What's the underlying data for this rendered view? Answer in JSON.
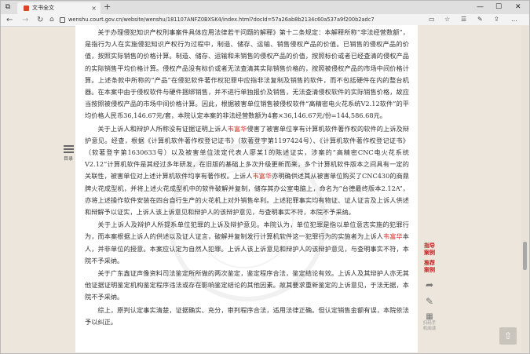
{
  "browser": {
    "tab_title": "文书全文",
    "tab_close": "×",
    "new_tab": "+",
    "url": "wenshu.court.gov.cn/website/wenshu/181107ANFZ0BXSK4/index.html?docId=57a26ab8b2134c60a537a9f200b2adc7",
    "controls": {
      "minimize": "—",
      "maximize": "☐",
      "close": "✕"
    },
    "nav": {
      "back": "←",
      "forward": "→",
      "refresh": "↻"
    },
    "toolbar_icons": [
      "reading-view-icon",
      "favorites-star-icon",
      "favorites-list-icon",
      "pen-icon",
      "share-icon",
      "more-icon"
    ]
  },
  "document": {
    "paragraphs": [
      [
        {
          "t": "关于办理侵犯知识产权刑事案件具体应用法律若干问题的解释》第十二条规定：本解释所称“非法经营数额”，是指行为人在实施侵犯知识产权行为过程中，制造、储存、运输、销售侵权产品的价值。已销售的侵权产品的价值，按照实际销售的价格计算。制造、储存、运输和未销售的侵权产品的价值，按照标价或者已经查清的侵权产品的实际销售平均价格计算。侵权产品没有标价或者无法查清其实际销售价格的，按照被侵权产品的市场中间价格计算。上述条款中所称的“产品”在侵犯软件著作权犯罪中应指非法复制及销售的软件，而不包括硬件在内的整台机器。在本案中由于侵权软件与硬件捆绑销售，并不进行单独报价及销售，无法查清侵权软件的实际销售价格，故应当按照被侵权产品的市场中间价格计算。因此，根据被害单位销售被侵权软件“高精密电火花系统V2.12软件”的平均价格人民币36,146.67元/套，本院认定本案的非法经营数额为4套×36,146.67元/份=144,586.68元。"
        }
      ],
      [
        {
          "t": "关于上诉人和辩护人所称没有证据证明上诉人"
        },
        {
          "t": "韦富华",
          "red": true
        },
        {
          "t": "侵害了被害单位享有计算机软件著作权的软件的上诉及辩护意见。经查，根据《计算机软件著作权登记证书》（软著登字第1197424号）、《计算机软件著作权登记证书》（软著登字第1630633号）以及被害单位法定代表人廖某1的陈述证实，涉案的“高精密CNC电火花系统V2.12”计算机软件是其经过多年研发，在旧版的基础上多次升级更新而来，多个计算机软件版本之间具有一定的关联性，被害单位对上述计算机软件均享有著作权。上诉人"
        },
        {
          "t": "韦富华",
          "red": true
        },
        {
          "t": "亦明确供述其从被害单位购买了CNC430的商鼎牌火花成型机，并将上述火花成型机中的软件破解并复制，储存其办公室电脑上，命名为“台德最终版本2.12A”，亦将上述操作软件安装在四台自行生产的火花机上对外销售牟利。上述犯罪事实均有物证、证人证言及上诉人供述和辩解予以证实，上诉人该上诉意见和辩护人的该辩护意见，与查明事实不符，本院不予采纳。"
        }
      ],
      [
        {
          "t": "关于上诉人及辩护人所提系单位犯罪的上诉及辩护意见。本院认为，单位犯罪是指以单位意志实施的犯罪行为，而本案根据上诉人的供述以及证人证言，破解并复制发行计算机软件这一犯罪行为的实施者为上诉人"
        },
        {
          "t": "韦富华",
          "red": true
        },
        {
          "t": "本人，并非单位的授意。本案应认定为自然人犯罪。上诉人该上诉意见和辩护人的该辩护意见，与查明事实不符，本院不予采纳。"
        }
      ],
      [
        {
          "t": "关于广东鑫证声像资料司法鉴定所所做的两次鉴定，鉴定程序合法，鉴定结论有效。上诉人及其辩护人亦无其他证据证明鉴定机构鉴定程序违法或存在影响鉴定结论的其他因素。故其要求重新鉴定的上诉意见，于法无据，本院不予采纳。"
        }
      ],
      [
        {
          "t": "综上，原判认定事实清楚，证据确实、充分，审判程序合法，适用法律正确。但认定销售金额有误，本院依法予以纠正。"
        }
      ]
    ]
  },
  "toc": {
    "label": "目录"
  },
  "sidebar": {
    "guide_case": "指导案例",
    "recommend_case": "推荐案例",
    "scan_label": "扫码手机阅读"
  },
  "back_to_top": "⇧"
}
